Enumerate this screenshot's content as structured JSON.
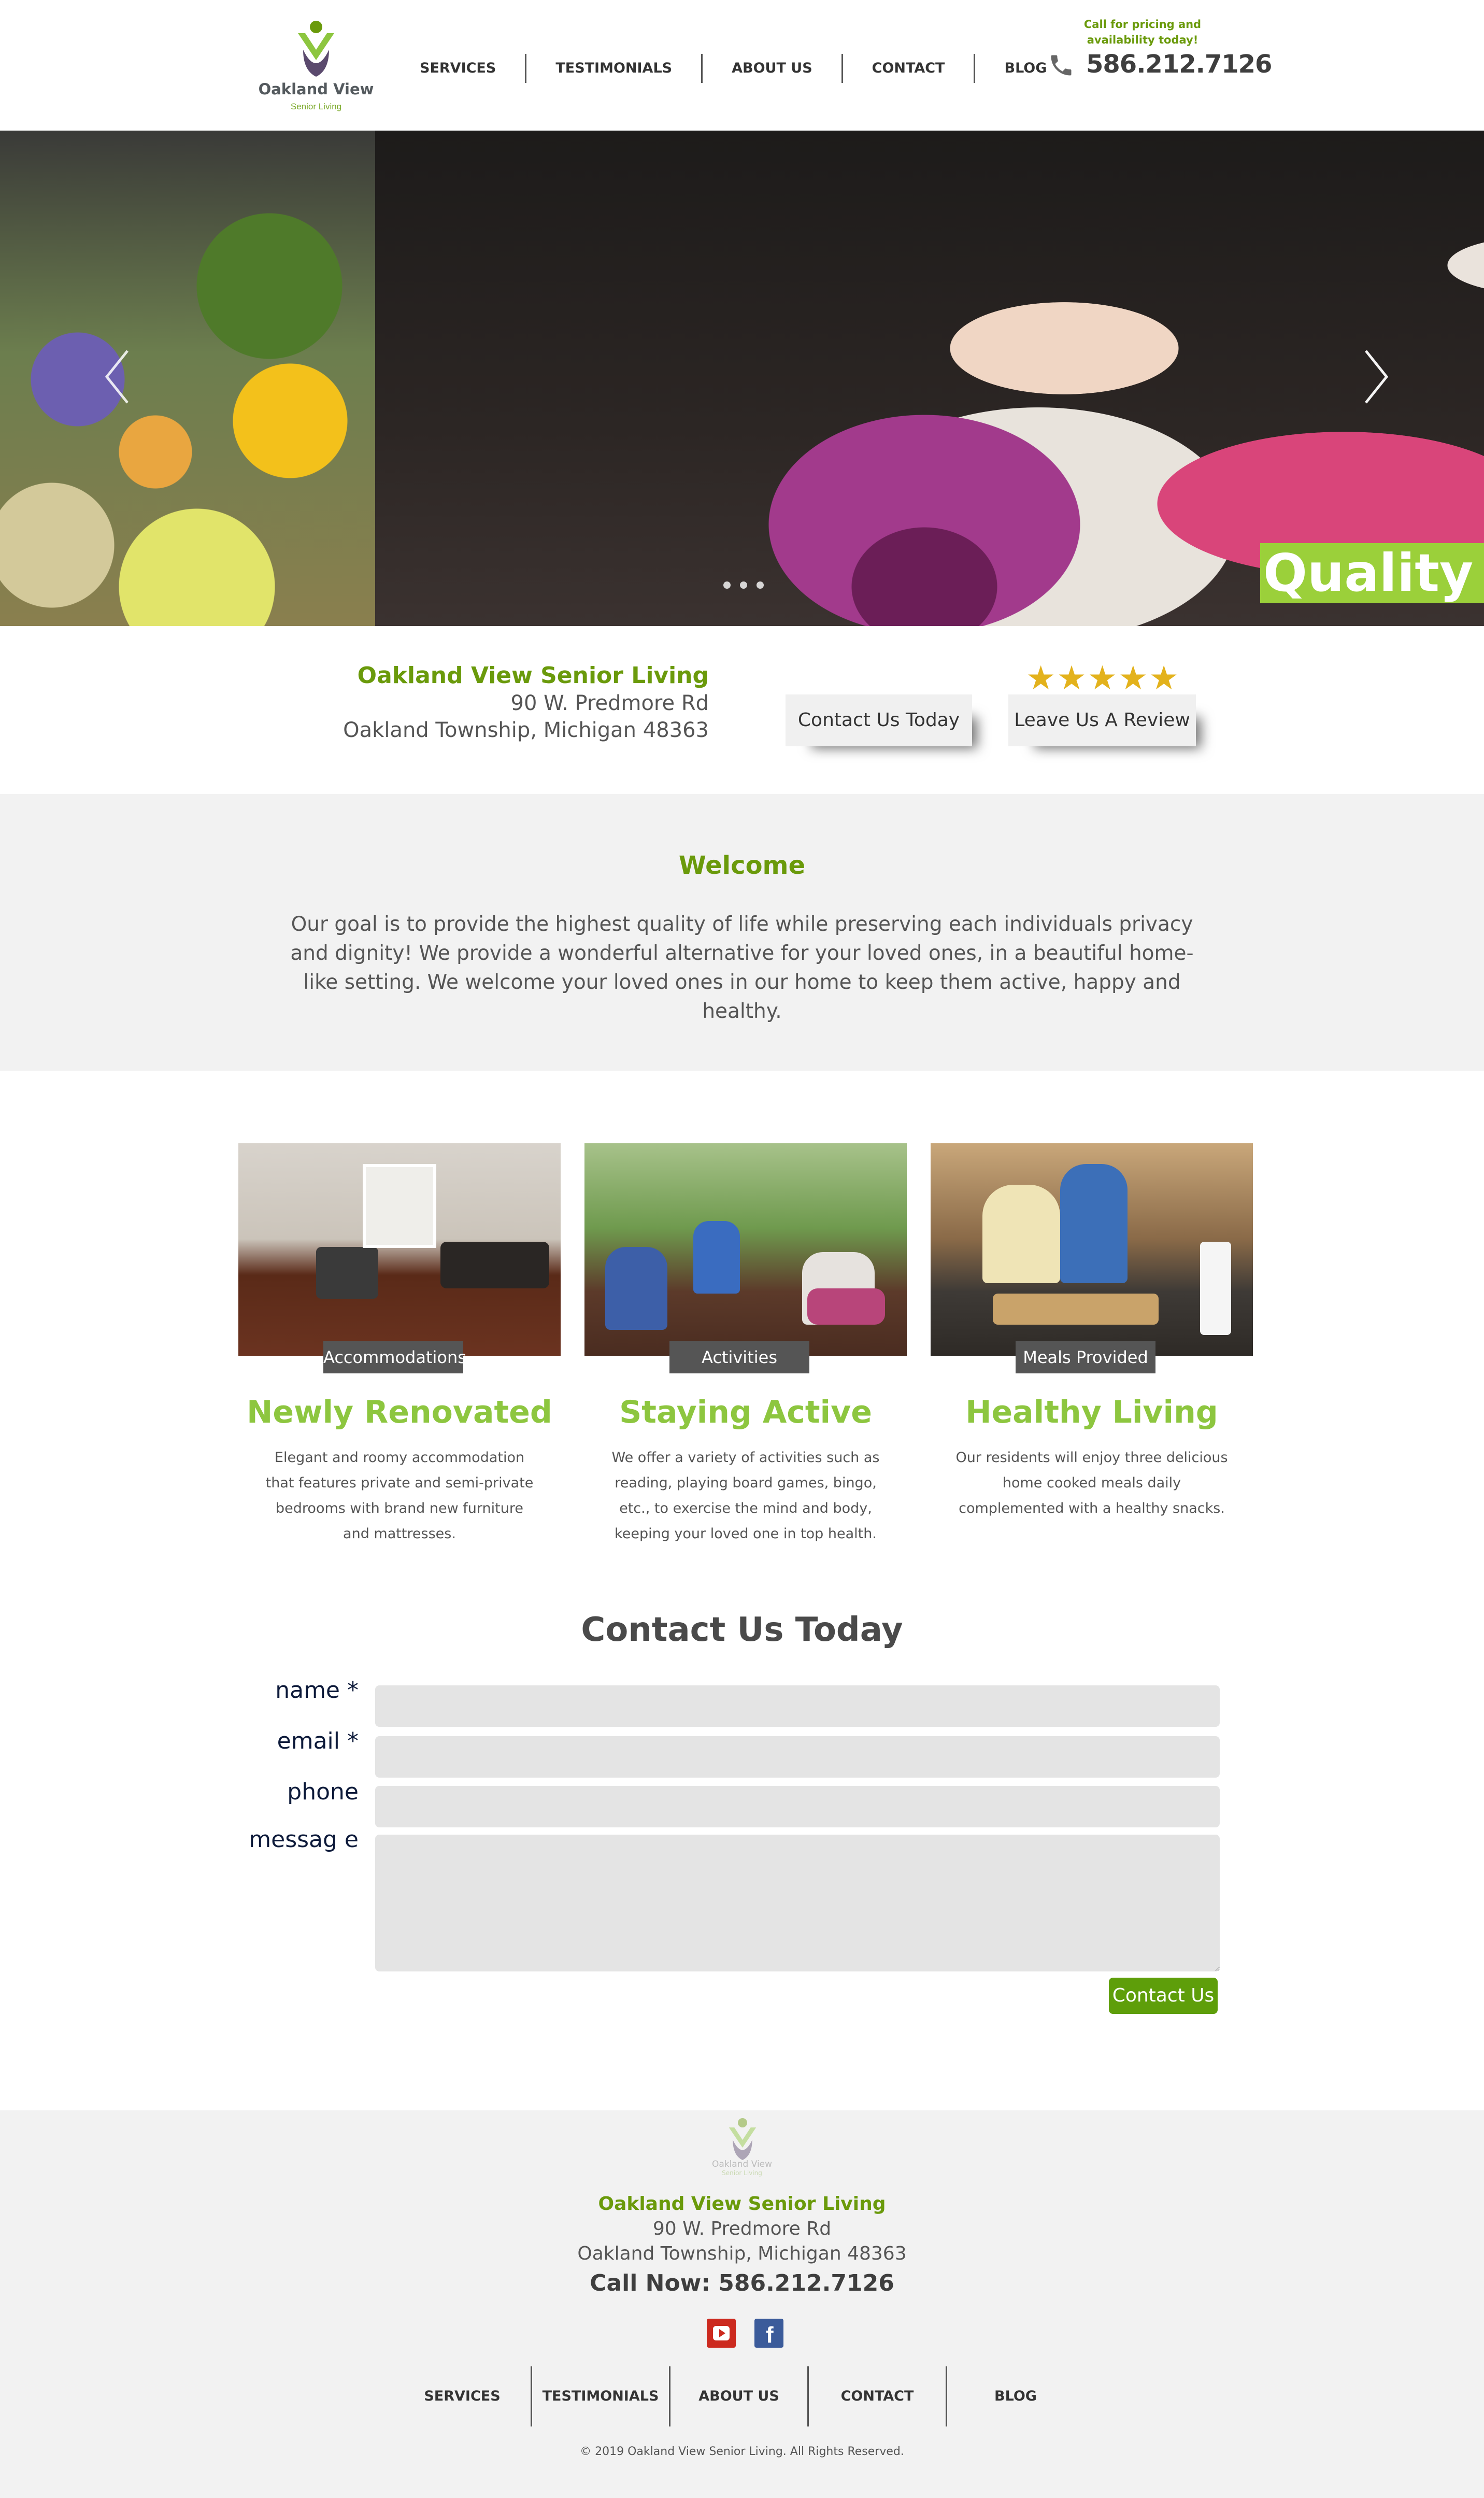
{
  "header": {
    "logo_text": "Oakland View",
    "logo_sub": "Senior Living",
    "nav": [
      "SERVICES",
      "TESTIMONIALS",
      "ABOUT US",
      "CONTACT",
      "BLOG"
    ],
    "call_text_1": "Call for pricing and",
    "call_text_2": "availability today!",
    "phone": "586.212.7126"
  },
  "hero": {
    "banner_text": "Quality o",
    "slide_count": 3
  },
  "address": {
    "name": "Oakland View Senior Living",
    "street": "90 W. Predmore Rd",
    "city": "Oakland Township, Michigan 48363",
    "contact_button": "Contact Us Today",
    "review_button": "Leave Us A Review",
    "stars": "★★★★★",
    "rating": 5
  },
  "welcome": {
    "title": "Welcome",
    "text": "Our goal is to provide the highest quality of life while preserving each individuals privacy and dignity! We provide a wonderful alternative for your loved ones, in a beautiful home-like setting. We welcome your loved ones in our home to keep them active, happy and healthy."
  },
  "features": [
    {
      "caption": "Accommodations",
      "title": "Newly Renovated",
      "desc": "Elegant and roomy accommodation that features private and semi-private bedrooms with brand new furniture and mattresses."
    },
    {
      "caption": "Activities",
      "title": "Staying Active",
      "desc": "We offer a variety of activities such as reading, playing board games, bingo, etc., to exercise the mind and body, keeping your loved one in top health."
    },
    {
      "caption": "Meals Provided",
      "title": "Healthy Living",
      "desc": "Our residents will enjoy three delicious home cooked meals daily complemented with a healthy snacks."
    }
  ],
  "contact_form": {
    "title": "Contact Us Today",
    "name_label": "name *",
    "email_label": "email *",
    "phone_label": "phone",
    "message_label": "messag e",
    "submit": "Contact Us"
  },
  "footer": {
    "logo_text": "Oakland View",
    "logo_sub": "Senior Living",
    "name": "Oakland View Senior Living",
    "street": "90 W. Predmore Rd",
    "city": "Oakland Township, Michigan 48363",
    "call": "Call Now: 586.212.7126",
    "nav": [
      "SERVICES",
      "TESTIMONIALS",
      "ABOUT US",
      "CONTACT",
      "BLOG"
    ],
    "copyright": "© 2019 Oakland View Senior Living. All Rights Reserved."
  },
  "colors": {
    "brand_green": "#6a9a0b",
    "light_green": "#8dc63f",
    "banner_green": "#9bd03a",
    "star_gold": "#e3b21c",
    "form_label_navy": "#0d1a3a"
  },
  "icons": {
    "phone": "phone-icon",
    "prev": "chevron-left-icon",
    "next": "chevron-right-icon",
    "youtube": "youtube-icon",
    "facebook": "facebook-icon"
  }
}
